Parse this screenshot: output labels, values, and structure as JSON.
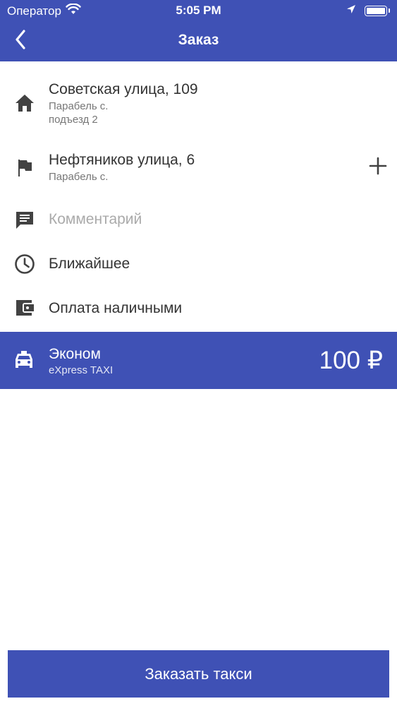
{
  "status_bar": {
    "carrier": "Оператор",
    "time": "5:05 PM"
  },
  "nav": {
    "title": "Заказ",
    "back_icon": "chevron-left-icon"
  },
  "route": {
    "from": {
      "street": "Советская улица, 109",
      "city": "Парабель с.",
      "entrance": "подъезд 2",
      "icon": "home-icon"
    },
    "to": {
      "street": "Нефтяников улица, 6",
      "city": "Парабель с.",
      "icon": "flag-icon",
      "add_icon": "plus-icon"
    }
  },
  "comment": {
    "placeholder": "Комментарий",
    "icon": "comment-icon"
  },
  "time_option": {
    "label": "Ближайшее",
    "icon": "clock-icon"
  },
  "payment": {
    "label": "Оплата наличными",
    "icon": "wallet-icon"
  },
  "tariff": {
    "name": "Эконом",
    "company": "eXpress TAXI",
    "price": "100 ₽",
    "icon": "taxi-icon"
  },
  "order_button": {
    "label": "Заказать такси"
  },
  "colors": {
    "accent": "#3f51b5",
    "icon": "#424242",
    "secondary_text": "#777777"
  }
}
